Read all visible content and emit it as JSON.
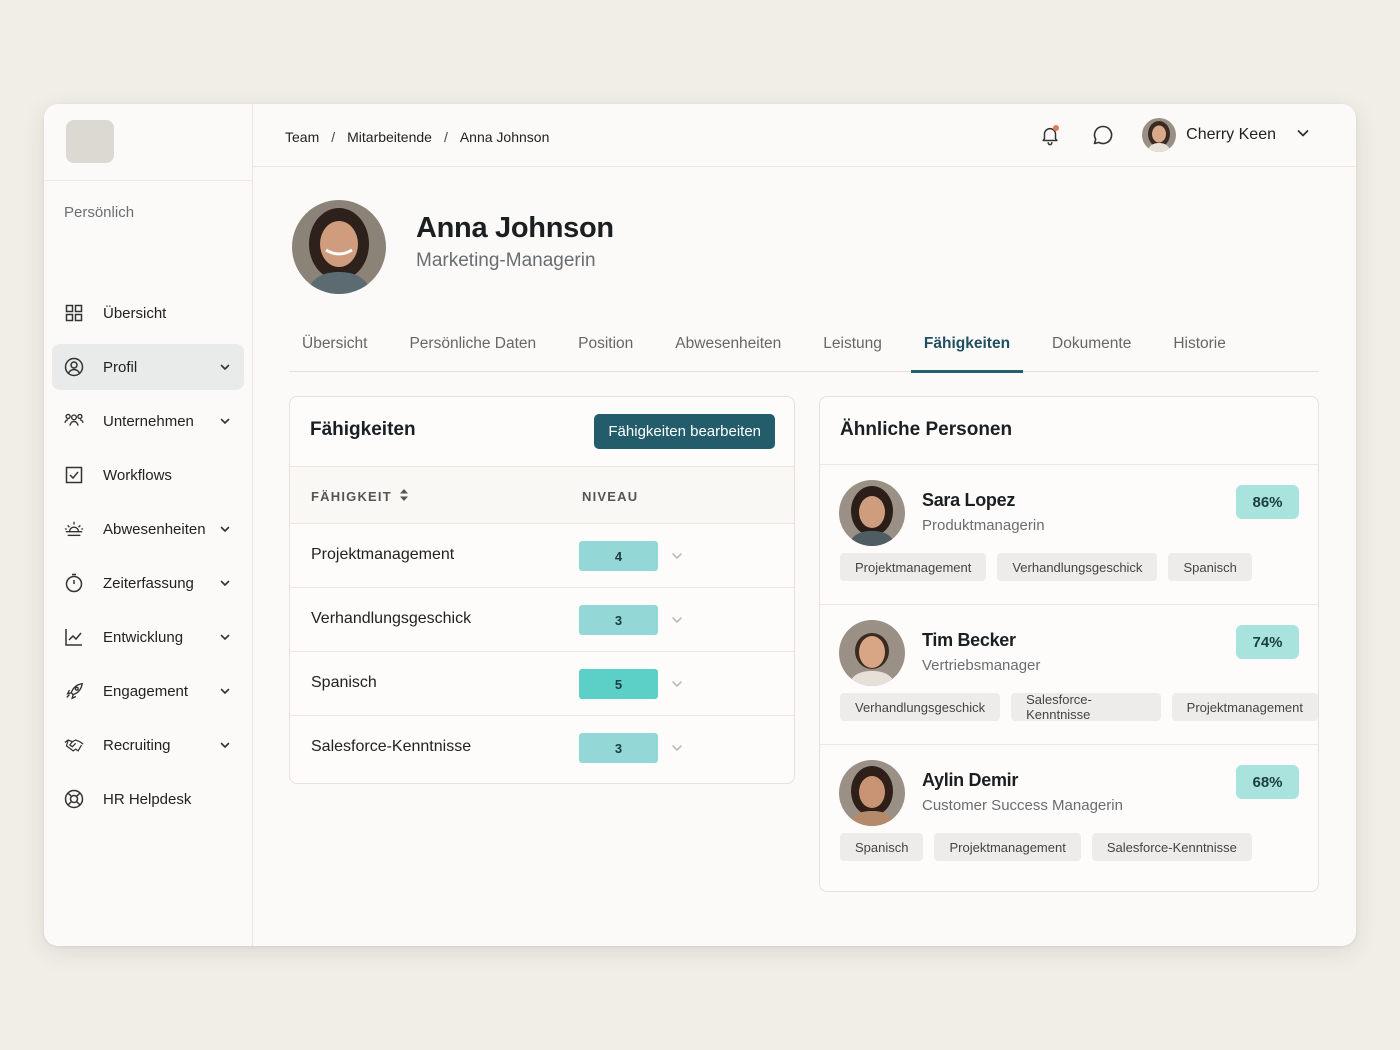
{
  "sidebar": {
    "section_label": "Persönlich",
    "items": [
      {
        "label": "Übersicht",
        "icon": "grid-icon",
        "has_chevron": false,
        "active": false
      },
      {
        "label": "Profil",
        "icon": "user-circle-icon",
        "has_chevron": true,
        "active": true
      },
      {
        "label": "Unternehmen",
        "icon": "users-icon",
        "has_chevron": true,
        "active": false
      },
      {
        "label": "Workflows",
        "icon": "checkbox-icon",
        "has_chevron": false,
        "active": false
      },
      {
        "label": "Abwesenheiten",
        "icon": "sunrise-icon",
        "has_chevron": true,
        "active": false
      },
      {
        "label": "Zeiterfassung",
        "icon": "stopwatch-icon",
        "has_chevron": true,
        "active": false
      },
      {
        "label": "Entwicklung",
        "icon": "chart-line-icon",
        "has_chevron": true,
        "active": false
      },
      {
        "label": "Engagement",
        "icon": "rocket-icon",
        "has_chevron": true,
        "active": false
      },
      {
        "label": "Recruiting",
        "icon": "handshake-icon",
        "has_chevron": true,
        "active": false
      },
      {
        "label": "HR Helpdesk",
        "icon": "lifebuoy-icon",
        "has_chevron": false,
        "active": false
      }
    ]
  },
  "breadcrumb": {
    "items": [
      "Team",
      "Mitarbeitende",
      "Anna Johnson"
    ],
    "separator": "/"
  },
  "topbar": {
    "user_name": "Cherry Keen"
  },
  "profile": {
    "name": "Anna Johnson",
    "role": "Marketing-Managerin"
  },
  "tabs": [
    {
      "label": "Übersicht",
      "active": false
    },
    {
      "label": "Persönliche Daten",
      "active": false
    },
    {
      "label": "Position",
      "active": false
    },
    {
      "label": "Abwesenheiten",
      "active": false
    },
    {
      "label": "Leistung",
      "active": false
    },
    {
      "label": "Fähigkeiten",
      "active": true
    },
    {
      "label": "Dokumente",
      "active": false
    },
    {
      "label": "Historie",
      "active": false
    }
  ],
  "skills_card": {
    "title": "Fähigkeiten",
    "edit_button": "Fähigkeiten bearbeiten",
    "col_skill": "FÄHIGKEIT",
    "col_level": "NIVEAU",
    "rows": [
      {
        "name": "Projektmanagement",
        "level": "4",
        "color": "#93d8d6"
      },
      {
        "name": "Verhandlungsgeschick",
        "level": "3",
        "color": "#93d8d6"
      },
      {
        "name": "Spanisch",
        "level": "5",
        "color": "#5ccfc7"
      },
      {
        "name": "Salesforce-Kenntnisse",
        "level": "3",
        "color": "#93d8d6"
      }
    ]
  },
  "similar_card": {
    "title": "Ähnliche Personen",
    "people": [
      {
        "name": "Sara Lopez",
        "role": "Produktmanagerin",
        "match": "86%",
        "tags": [
          "Projektmanagement",
          "Verhandlungsgeschick",
          "Spanisch"
        ]
      },
      {
        "name": "Tim Becker",
        "role": "Vertriebsmanager",
        "match": "74%",
        "tags": [
          "Verhandlungsgeschick",
          "Salesforce-Kenntnisse",
          "Projektmanagement"
        ]
      },
      {
        "name": "Aylin Demir",
        "role": "Customer Success Managerin",
        "match": "68%",
        "tags": [
          "Spanisch",
          "Projektmanagement",
          "Salesforce-Kenntnisse"
        ]
      }
    ]
  },
  "colors": {
    "accent": "#235c6b",
    "match_badge": "#a8e3de",
    "notification_dot": "#e07a5f"
  }
}
